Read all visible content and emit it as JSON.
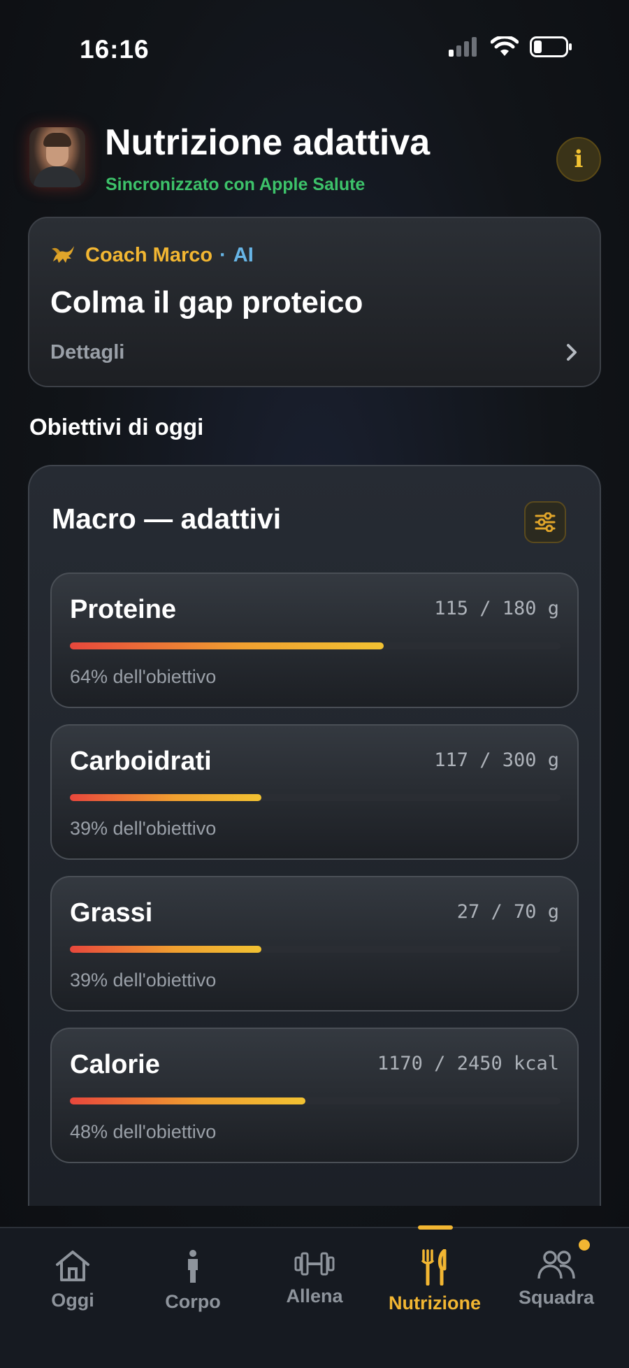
{
  "status_bar": {
    "time": "16:16"
  },
  "header": {
    "title": "Nutrizione adattiva",
    "subtitle": "Sincronizzato con Apple Salute"
  },
  "coach": {
    "name": "Coach Marco",
    "separator": "·",
    "badge": "AI",
    "headline": "Colma il gap proteico",
    "details_label": "Dettagli"
  },
  "section_title": "Obiettivi di oggi",
  "macros": {
    "title": "Macro — adattivi",
    "items": [
      {
        "name": "Proteine",
        "value": "115 / 180 g",
        "percent_label": "64% dell'obiettivo",
        "progress": 0.64
      },
      {
        "name": "Carboidrati",
        "value": "117 / 300 g",
        "percent_label": "39% dell'obiettivo",
        "progress": 0.39
      },
      {
        "name": "Grassi",
        "value": "27 / 70 g",
        "percent_label": "39% dell'obiettivo",
        "progress": 0.39
      },
      {
        "name": "Calorie",
        "value": "1170 / 2450 kcal",
        "percent_label": "48% dell'obiettivo",
        "progress": 0.48
      }
    ]
  },
  "tabs": [
    {
      "label": "Oggi",
      "icon": "home-icon"
    },
    {
      "label": "Corpo",
      "icon": "person-icon"
    },
    {
      "label": "Allena",
      "icon": "dumbbell-icon"
    },
    {
      "label": "Nutrizione",
      "icon": "fork-knife-icon",
      "active": true
    },
    {
      "label": "Squadra",
      "icon": "team-icon",
      "badge": true
    }
  ],
  "colors": {
    "accent": "#f2b632",
    "sync_green": "#3dc26a",
    "ai_blue": "#67b5e6",
    "progress_start": "#e8473c",
    "progress_end": "#f2c232"
  }
}
